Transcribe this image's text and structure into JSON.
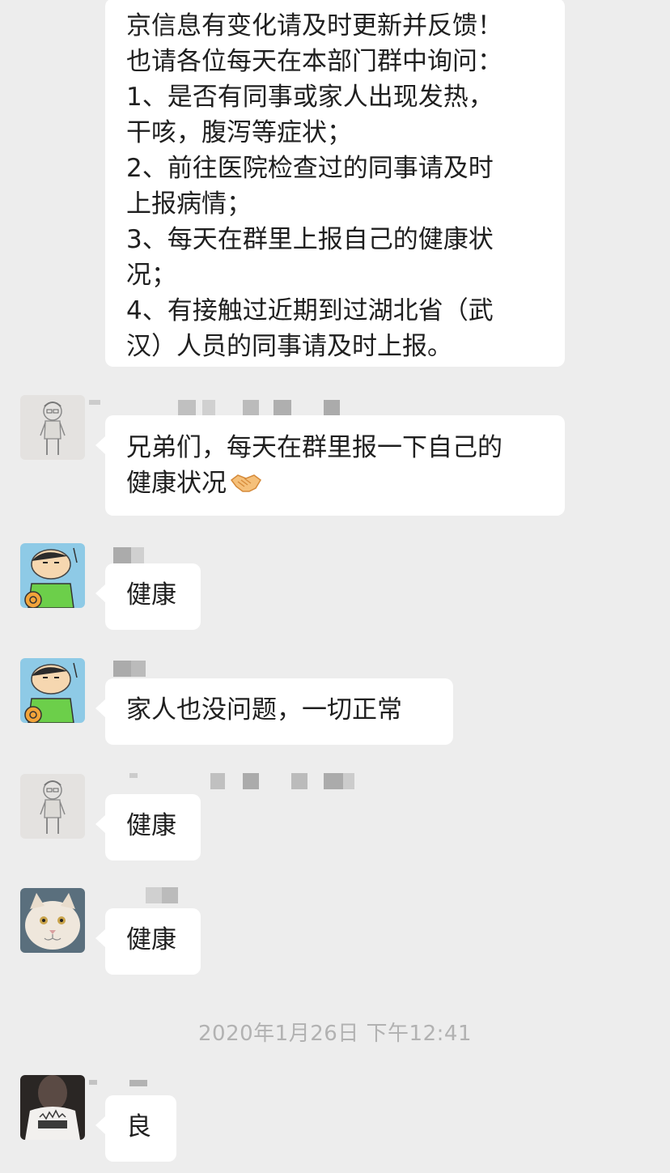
{
  "messages": [
    {
      "lines": [
        "京信息有变化请及时更新并反馈！",
        "也请各位每天在本部门群中询问：",
        "1、是否有同事或家人出现发热，",
        "干咳，腹泻等症状；",
        "2、前往医院检查过的同事请及时",
        "上报病情；",
        "3、每天在群里上报自己的健康状",
        "况；",
        "4、有接触过近期到过湖北省（武",
        "汉）人员的同事请及时上报。"
      ]
    },
    {
      "lines": [
        "兄弟们，每天在群里报一下自己的",
        "健康状况"
      ],
      "emoji": "handshake-emoji",
      "avatar": "avatar-sketch-boy"
    },
    {
      "text": "健康",
      "avatar": "avatar-cartoon-boy"
    },
    {
      "text": "家人也没问题，一切正常",
      "avatar": "avatar-cartoon-boy"
    },
    {
      "text": "健康",
      "avatar": "avatar-sketch-boy"
    },
    {
      "text": "健康",
      "avatar": "avatar-cat"
    },
    {
      "text": "良",
      "avatar": "avatar-person-shirt"
    }
  ],
  "timestamp": "2020年1月26日 下午12:41",
  "colors": {
    "background": "#ededed",
    "bubble": "#ffffff",
    "text": "#1f1f1f",
    "timestamp": "#b2b2b2"
  }
}
